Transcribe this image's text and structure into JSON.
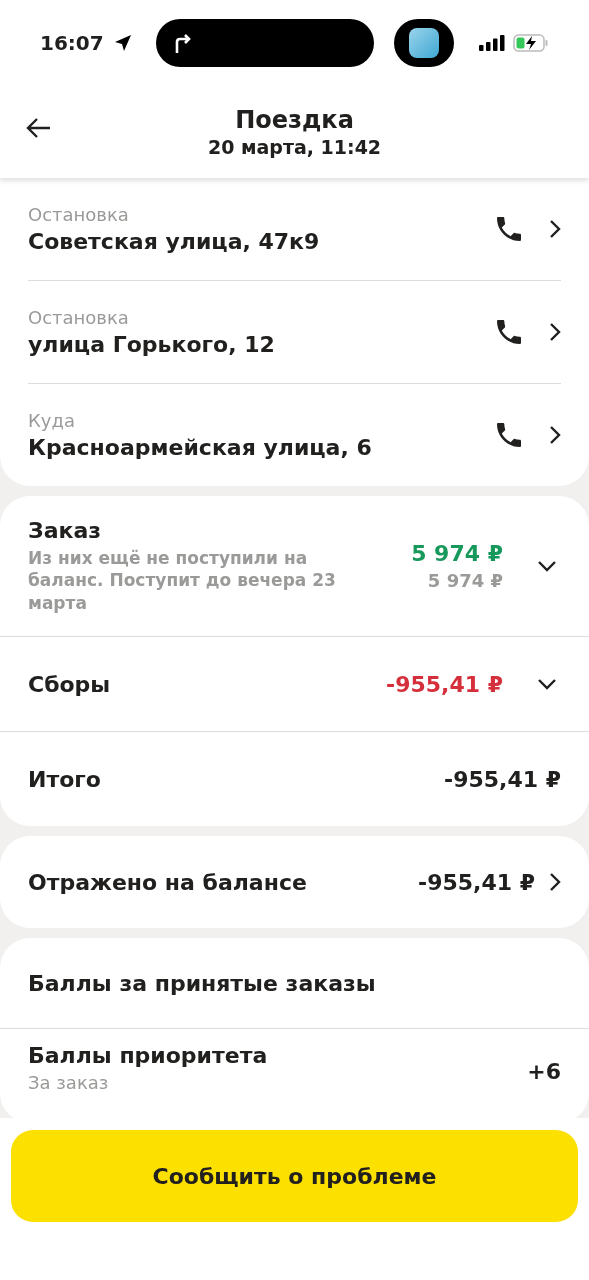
{
  "status_bar": {
    "time": "16:07"
  },
  "header": {
    "title": "Поездка",
    "subtitle": "20 марта, 11:42"
  },
  "stops": [
    {
      "label": "Остановка",
      "address": "Советская улица, 47к9"
    },
    {
      "label": "Остановка",
      "address": "улица Горького, 12"
    },
    {
      "label": "Куда",
      "address": "Красноармейская улица, 6"
    }
  ],
  "order_card": {
    "rows": [
      {
        "title": "Заказ",
        "note": "Из них ещё не поступили на баланс. Поступит до вечера 23 марта",
        "amount": "5 974 ₽",
        "color": "#16995a",
        "secondary_amount": "5 974 ₽",
        "expandable": true
      },
      {
        "title": "Сборы",
        "amount": "-955,41 ₽",
        "color": "#d42f3b",
        "expandable": true
      },
      {
        "title": "Итого",
        "amount": "-955,41 ₽",
        "color": "#21201f",
        "expandable": false
      }
    ]
  },
  "balance": {
    "title": "Отражено на балансе",
    "amount": "-955,41 ₽"
  },
  "points": {
    "title": "Баллы за принятые заказы",
    "rows": [
      {
        "title": "Баллы приоритета",
        "note": "За заказ",
        "value": "+6"
      }
    ]
  },
  "report_button": {
    "label": "Сообщить о проблеме"
  }
}
